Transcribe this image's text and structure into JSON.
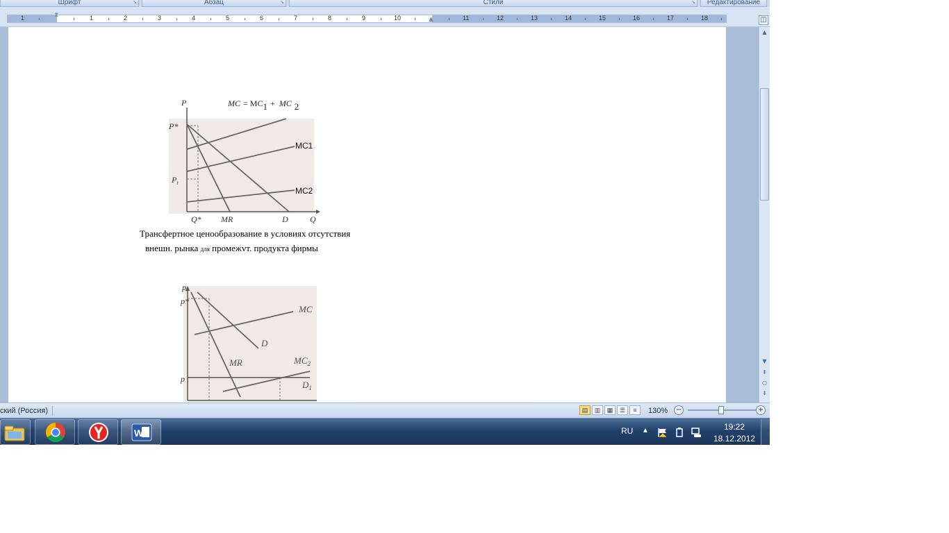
{
  "ribbon": {
    "groups": [
      "Шрифт",
      "Абзац",
      "Стили",
      "Редактирование"
    ]
  },
  "ruler": {
    "numbers": [
      "1",
      "1",
      "2",
      "3",
      "4",
      "5",
      "6",
      "7",
      "8",
      "9",
      "10",
      "11",
      "12",
      "13",
      "14",
      "15",
      "16",
      "17",
      "18",
      "19"
    ]
  },
  "document": {
    "figure1": {
      "axis_p": "P",
      "formula_mc": "MC",
      "formula_eq": "= MC",
      "formula_sub1": "1",
      "formula_plus": "+",
      "formula_mc2": "MC",
      "formula_sub2": "2",
      "label_pstar": "P*",
      "label_pt": "P",
      "label_pt_sub": "t",
      "label_mc1": "MC1",
      "label_mc2": "MC2",
      "label_qstar": "Q*",
      "label_mr": "MR",
      "label_d": "D",
      "label_q": "Q"
    },
    "caption1": {
      "line1": "Трансфертное  ценообразование  в  условиях отсутствия",
      "line2_a": "внешн. рынка",
      "line2_b": "для",
      "line2_c": "промежvт. продукта фирмы"
    },
    "figure2": {
      "axis_p": "p",
      "label_pstar": "p*",
      "label_mc": "MC",
      "label_d": "D",
      "label_mr": "MR",
      "label_mc2": "MC",
      "label_mc2_sub": "2",
      "label_p": "p",
      "label_d1": "D",
      "label_d1_sub": "1"
    }
  },
  "statusbar": {
    "language": "ский (Россия)",
    "zoom": "130%"
  },
  "taskbar": {
    "tray_lang": "RU",
    "time": "19:22",
    "date": "18.12.2012"
  },
  "colors": {
    "ribbon_bg": "#c9daf0",
    "doc_background": "#a9bdd9",
    "figure_bg": "#efe9e7",
    "taskbar": "#22416b"
  },
  "icons": [
    "explorer-icon",
    "chrome-icon",
    "yandex-browser-icon",
    "word-icon",
    "flag-icon",
    "power-icon",
    "network-icon"
  ]
}
